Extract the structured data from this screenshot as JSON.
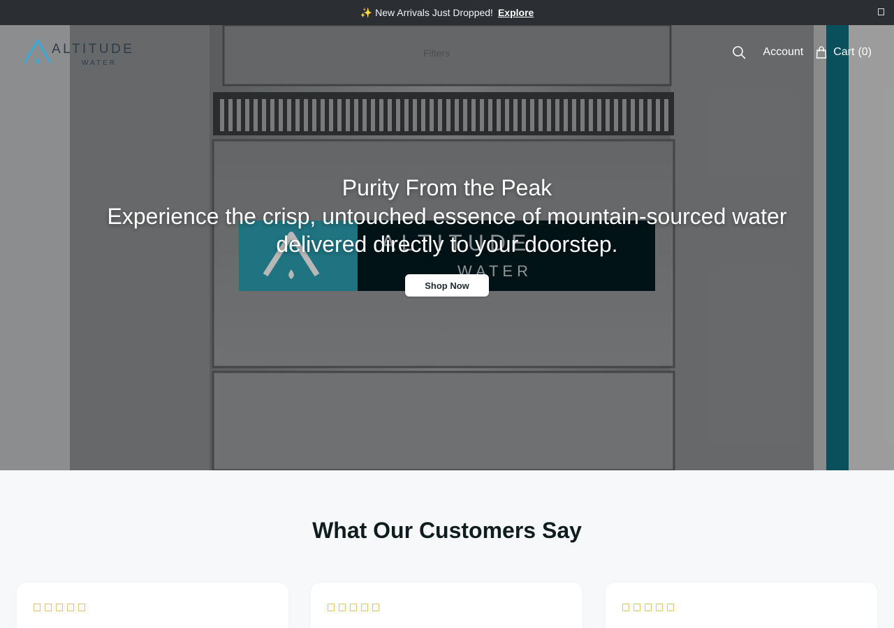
{
  "announcement": {
    "emoji": "✨",
    "text": "New Arrivals Just Dropped!",
    "link": "Explore"
  },
  "header": {
    "logo_main": "ALTITUDE",
    "logo_sub": "WATER",
    "filters": "Filters",
    "account": "Account",
    "cart_label": "Cart",
    "cart_count": "(0)"
  },
  "hero": {
    "title": "Purity From the Peak",
    "subtitle": "Experience the crisp, untouched essence of mountain-sourced water delivered directly to your doorstep.",
    "cta": "Shop Now",
    "dispenser_logo_main": "ALTITUDE",
    "dispenser_logo_sub": "WATER"
  },
  "reviews": {
    "title": "What Our Customers Say",
    "cards": [
      {
        "rating": 5
      },
      {
        "rating": 5
      },
      {
        "rating": 5
      }
    ]
  },
  "colors": {
    "brand_blue": "#3aa8d8",
    "announcement_bg": "#2b2f33",
    "accent_teal": "#0f6e80"
  },
  "icons": [
    "sparkle-icon",
    "close-icon",
    "search-icon",
    "shopping-bag-icon",
    "star-icon"
  ]
}
